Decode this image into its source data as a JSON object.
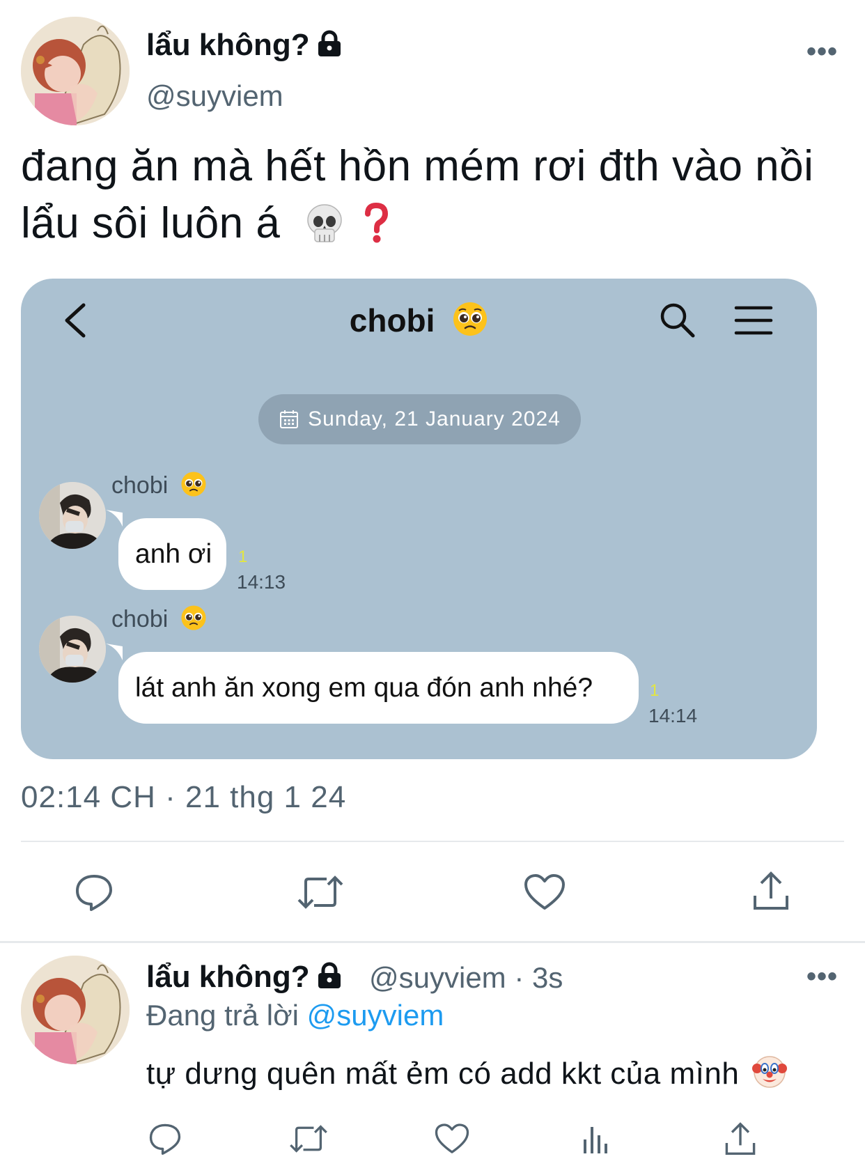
{
  "tweet": {
    "display_name": "lẩu không?",
    "handle": "@suyviem",
    "more_label": "•••",
    "text_line1": "đang ăn mà hết hồn mém rơi đth vào nồi",
    "text_line2": "lẩu sôi luôn á",
    "emojis": [
      "skull-emoji",
      "red-question-mark-emoji"
    ],
    "timestamp": "02:14 CH · 21 thg 1 24",
    "actions": [
      "reply-icon",
      "retweet-icon",
      "like-icon",
      "share-icon"
    ]
  },
  "chat": {
    "title": "chobi",
    "date": "Sunday, 21 January 2024",
    "messages": [
      {
        "sender": "chobi",
        "text": "anh ơi",
        "read": "1",
        "time": "14:13"
      },
      {
        "sender": "chobi",
        "text": "lát anh ăn xong em qua đón anh nhé?",
        "read": "1",
        "time": "14:14"
      }
    ],
    "background": "#abc1d1"
  },
  "reply": {
    "display_name": "lẩu không?",
    "handle_time": "@suyviem · 3s",
    "replying_prefix": "Đang trả lời",
    "replying_to": "@suyviem",
    "text": "tự dưng quên mất ẻm có add kkt của mình",
    "more_label": "•••",
    "actions": [
      "reply-icon",
      "retweet-icon",
      "like-icon",
      "views-icon",
      "share-icon"
    ]
  },
  "colors": {
    "accent": "#1d9bf0",
    "secondary_text": "#536471"
  }
}
